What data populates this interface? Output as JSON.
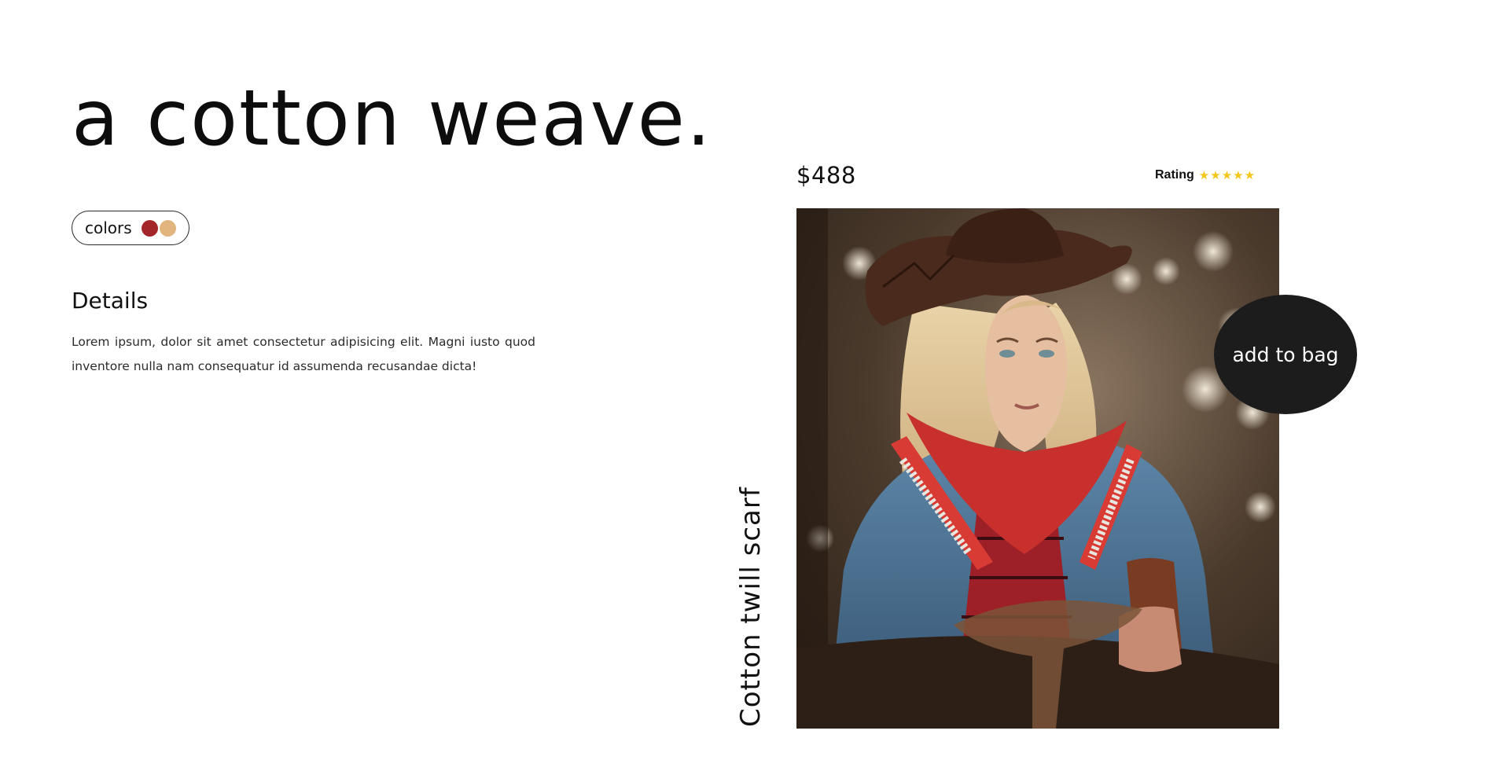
{
  "hero": {
    "headline": "a cotton weave."
  },
  "colors": {
    "label": "colors",
    "swatches": [
      {
        "name": "red-swatch",
        "color": "#a3262a"
      },
      {
        "name": "tan-swatch",
        "color": "#e2b47e"
      }
    ]
  },
  "details": {
    "heading": "Details",
    "text": "Lorem ipsum, dolor sit amet consectetur adipisicing elit. Magni iusto quod inventore nulla nam consequatur id assumenda recusandae dicta!"
  },
  "product": {
    "price": "$488",
    "rating_label": "Rating",
    "rating_stars": 5,
    "star_color": "#f5c518",
    "name": "Cotton twill scarf",
    "add_to_bag_label": "add to bag",
    "image_icon": "product-photo-cowgirl-scarf"
  }
}
